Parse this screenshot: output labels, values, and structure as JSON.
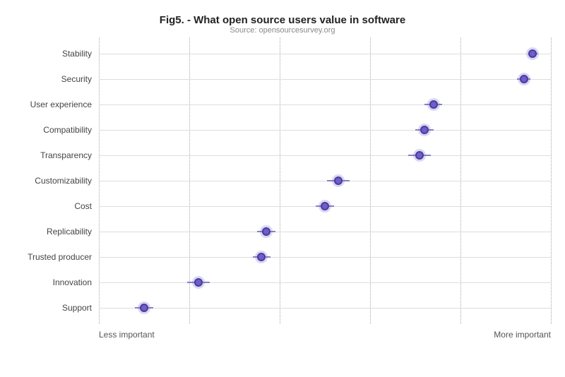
{
  "title": "Fig5. - What open source users value in software",
  "subtitle": "Source: opensourcesurvey.org",
  "axis": {
    "left": "Less important",
    "right": "More important"
  },
  "rows": [
    {
      "label": "Stability",
      "pct": 96,
      "err": 1
    },
    {
      "label": "Security",
      "pct": 94,
      "err": 1.5
    },
    {
      "label": "User experience",
      "pct": 74,
      "err": 2
    },
    {
      "label": "Compatibility",
      "pct": 72,
      "err": 2
    },
    {
      "label": "Transparency",
      "pct": 71,
      "err": 2.5
    },
    {
      "label": "Customizability",
      "pct": 53,
      "err": 2.5
    },
    {
      "label": "Cost",
      "pct": 50,
      "err": 2
    },
    {
      "label": "Replicability",
      "pct": 37,
      "err": 2
    },
    {
      "label": "Trusted producer",
      "pct": 36,
      "err": 2
    },
    {
      "label": "Innovation",
      "pct": 22,
      "err": 2.5
    },
    {
      "label": "Support",
      "pct": 10,
      "err": 2
    }
  ],
  "grid_lines": [
    0,
    20,
    40,
    60,
    80,
    100
  ]
}
